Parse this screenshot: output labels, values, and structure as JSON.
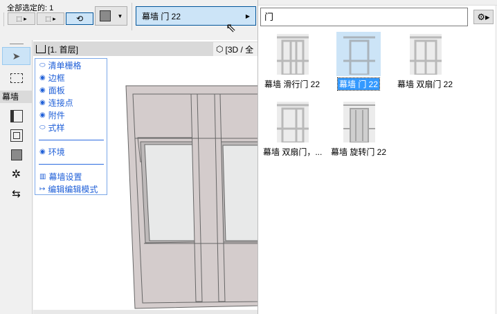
{
  "toolbar": {
    "selected_label": "全部选定的: 1",
    "favorite_label": "幕墙 门 22"
  },
  "sidebar": {
    "section_label": "幕墙"
  },
  "view": {
    "tab_floor": "[1. 首层]",
    "tab_3d": "[3D / 全"
  },
  "context_menu": {
    "items": [
      {
        "label": "清单栅格",
        "icon": "eye-closed-icon"
      },
      {
        "label": "边框",
        "icon": "eye-icon"
      },
      {
        "label": "面板",
        "icon": "eye-icon"
      },
      {
        "label": "连接点",
        "icon": "eye-icon"
      },
      {
        "label": "附件",
        "icon": "eye-icon"
      },
      {
        "label": "式样",
        "icon": "eye-closed-icon"
      },
      {
        "label": "环境",
        "icon": "eye-icon"
      },
      {
        "label": "幕墙设置",
        "icon": "curtain-wall-settings-icon"
      },
      {
        "label": "编辑编辑模式",
        "icon": "exit-edit-icon"
      }
    ]
  },
  "favorites_panel": {
    "search_value": "门",
    "items": [
      {
        "label": "幕墙 滑行门 22",
        "selected": false
      },
      {
        "label": "幕墙 门 22",
        "selected": true
      },
      {
        "label": "幕墙 双扇门 22",
        "selected": false
      },
      {
        "label": "幕墙 双扇门，...",
        "selected": false
      },
      {
        "label": "幕墙 旋转门 22",
        "selected": false
      }
    ]
  },
  "colors": {
    "accent": "#3399ff",
    "menu_text": "#2060d8",
    "selected_bg": "#cce4f7"
  }
}
